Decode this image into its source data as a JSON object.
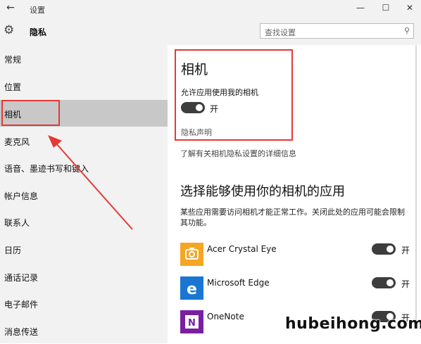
{
  "titlebar": {
    "back_glyph": "←",
    "title": "设置",
    "min_glyph": "—",
    "max_glyph": "☐",
    "close_glyph": "✕"
  },
  "header": {
    "title": "隐私",
    "search_placeholder": "查找设置"
  },
  "sidebar": {
    "items": [
      {
        "label": "常规"
      },
      {
        "label": "位置"
      },
      {
        "label": "相机"
      },
      {
        "label": "麦克风"
      },
      {
        "label": "语音、墨迹书写和键入"
      },
      {
        "label": "帐户信息"
      },
      {
        "label": "联系人"
      },
      {
        "label": "日历"
      },
      {
        "label": "通话记录"
      },
      {
        "label": "电子邮件"
      },
      {
        "label": "消息传送"
      }
    ],
    "active_index": 2
  },
  "main": {
    "title": "相机",
    "allow_label": "允许应用使用我的相机",
    "allow_toggle": "开",
    "privacy_statement": "隐私声明",
    "learn_more": "了解有关相机隐私设置的详细信息",
    "choose_title": "选择能够使用你的相机的应用",
    "description": "某些应用需要访问相机才能正常工作。关闭此处的应用可能会限制其功能。",
    "apps": [
      {
        "name": "Acer Crystal Eye",
        "toggle": "开",
        "icon": "camera-app-icon",
        "color": "#f5a623"
      },
      {
        "name": "Microsoft Edge",
        "toggle": "开",
        "icon": "edge-icon",
        "color": "#1976d2"
      },
      {
        "name": "OneNote",
        "toggle": "开",
        "icon": "onenote-icon",
        "color": "#7b1fa2"
      }
    ]
  },
  "accent": {
    "highlight": "#e53935"
  },
  "watermark": "hubeihong.com"
}
